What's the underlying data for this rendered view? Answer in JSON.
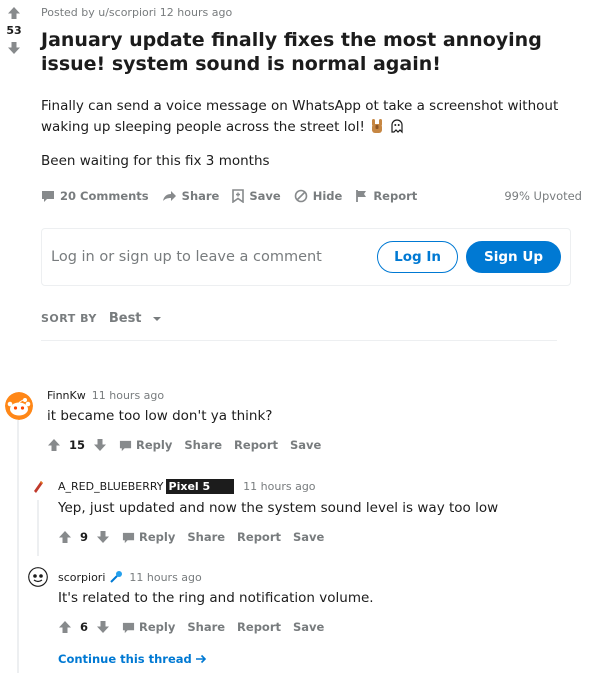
{
  "post": {
    "score": "53",
    "posted_by": "Posted by u/scorpiori 12 hours ago",
    "title": "January update finally fixes the most annoying issue! system sound is normal again!",
    "body": [
      "Finally can send a voice message on WhatsApp ot take a screenshot without waking up sleeping people across the street lol!",
      "Been waiting for this fix 3 months"
    ],
    "actions": {
      "comments": "20 Comments",
      "share": "Share",
      "save": "Save",
      "hide": "Hide",
      "report": "Report"
    },
    "upvoted": "99% Upvoted"
  },
  "comment_box": {
    "prompt": "Log in or sign up to leave a comment",
    "login": "Log In",
    "signup": "Sign Up"
  },
  "sort": {
    "label": "SORT BY",
    "value": "Best"
  },
  "comments": [
    {
      "user": "FinnKw",
      "time": "11 hours ago",
      "text": "it became too low don't ya think?",
      "score": "15",
      "actions": [
        "Reply",
        "Share",
        "Report",
        "Save"
      ]
    },
    {
      "user": "A_RED_BLUEBERRY",
      "flair": "Pixel 5",
      "time": "11 hours ago",
      "text": "Yep, just updated and now the system sound level is way too low",
      "score": "9",
      "actions": [
        "Reply",
        "Share",
        "Report",
        "Save"
      ]
    },
    {
      "user": "scorpiori",
      "time": "11 hours ago",
      "text": "It's related to the ring and notification volume.",
      "score": "6",
      "actions": [
        "Reply",
        "Share",
        "Report",
        "Save"
      ]
    }
  ],
  "continue_thread": "Continue this thread",
  "colors": {
    "accent": "#0079d3",
    "muted": "#787c7e",
    "text": "#1c1c1c",
    "divider": "#edeff1"
  }
}
